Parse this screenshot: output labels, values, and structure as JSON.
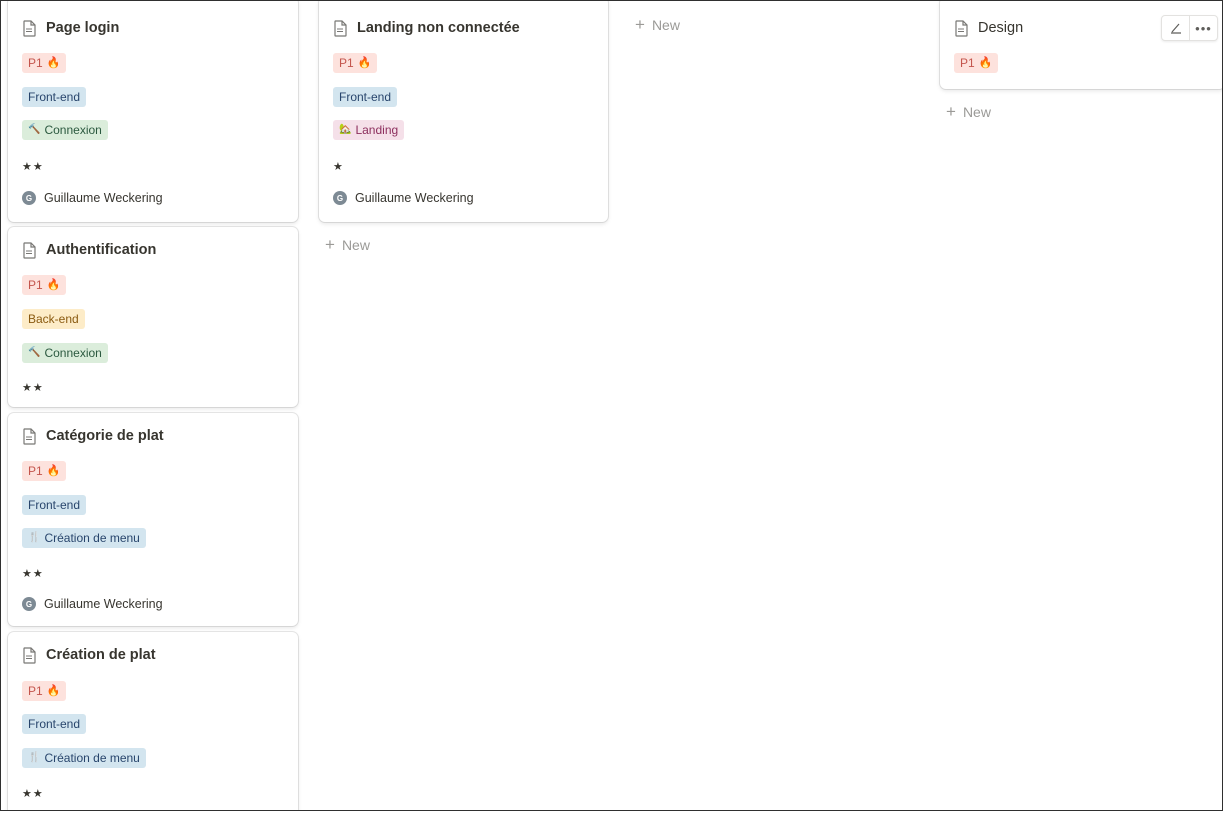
{
  "columns": [
    {
      "cards": [
        {
          "title": "Page login",
          "icon": "document-icon",
          "priority": "P1",
          "type": "Front-end",
          "feature": "Connexion",
          "stars": "★★",
          "assignee": "Guillaume Weckering",
          "assignee_initial": "G"
        },
        {
          "title": "Authentification",
          "icon": "document-icon",
          "priority": "P1",
          "type": "Back-end",
          "feature": "Connexion",
          "stars": "★★"
        },
        {
          "title": "Catégorie de plat",
          "icon": "document-icon",
          "priority": "P1",
          "type": "Front-end",
          "feature": "Création de menu",
          "stars": "★★",
          "assignee": "Guillaume Weckering",
          "assignee_initial": "G"
        },
        {
          "title": "Création de plat",
          "icon": "document-icon",
          "priority": "P1",
          "type": "Front-end",
          "feature": "Création de menu",
          "stars": "★★"
        }
      ]
    },
    {
      "cards": [
        {
          "title": "Landing non connectée",
          "icon": "document-icon",
          "priority": "P1",
          "type": "Front-end",
          "feature": "Landing",
          "stars": "★",
          "assignee": "Guillaume Weckering",
          "assignee_initial": "G"
        }
      ],
      "new_label": "New"
    },
    {
      "cards": [],
      "new_label": "New"
    },
    {
      "cards": [
        {
          "title": "Design",
          "icon": "document-icon",
          "priority": "P1"
        }
      ],
      "new_label": "New"
    }
  ],
  "colors": {
    "p1_bg": "#fde2dd",
    "front_end_bg": "#d3e5ef",
    "back_end_bg": "#fdecc8",
    "connexion_bg": "#dbeddb",
    "landing_bg": "#f5e0e9",
    "muted_text": "#9b9a97"
  }
}
